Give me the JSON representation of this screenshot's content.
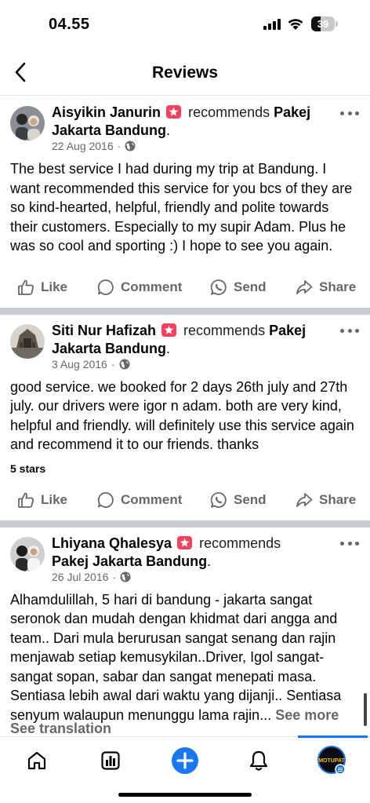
{
  "status_bar": {
    "time": "04.55",
    "battery": "39",
    "battery_level": 0.39
  },
  "header": {
    "title": "Reviews"
  },
  "reviews": [
    {
      "author": "Aisyikin Janurin",
      "verb": "recommends",
      "page": "Pakej Jakarta Bandung",
      "date": "22 Aug 2016",
      "text": "The best service I had during my trip at Bandung. I want recommended this service for you bcs of they are so kind-hearted, helpful, friendly and polite towards their customers. Especially to my supir Adam. Plus he was so cool and sporting :) I hope to see you again.",
      "stars": ""
    },
    {
      "author": "Siti Nur Hafizah",
      "verb": "recommends",
      "page": "Pakej Jakarta Bandung",
      "date": "3 Aug 2016",
      "text": "good service. we booked for 2 days 26th july and 27th july. our drivers were igor n adam. both are very kind, helpful and friendly. will definitely use this service again and recommend it to our friends. thanks",
      "stars": "5 stars"
    },
    {
      "author": "Lhiyana Qhalesya",
      "verb": "recommends",
      "page": "Pakej Jakarta Bandung",
      "date": "26 Jul 2016",
      "text": "Alhamdulillah, 5 hari di bandung - jakarta sangat seronok dan mudah dengan khidmat dari angga and team.. Dari mula berurusan sangat senang dan rajin menjawab setiap kemusykilan..Driver, Igol sangat-sangat sopan, sabar dan sangat menepati masa. Sentiasa lebih awal dari waktu yang dijanji.. Sentiasa senyum walaupun menunggu lama  rajin...",
      "see_more": "See more",
      "see_translation": "See translation"
    }
  ],
  "actions": {
    "like": "Like",
    "comment": "Comment",
    "send": "Send",
    "share": "Share"
  },
  "avatar_labels": {
    "profile_badge": "MOTUPAT"
  },
  "colors": {
    "accent": "#1877f2",
    "recommend_badge": "#f3425f",
    "secondary_text": "#65676b",
    "separator": "#c9ccd1"
  }
}
